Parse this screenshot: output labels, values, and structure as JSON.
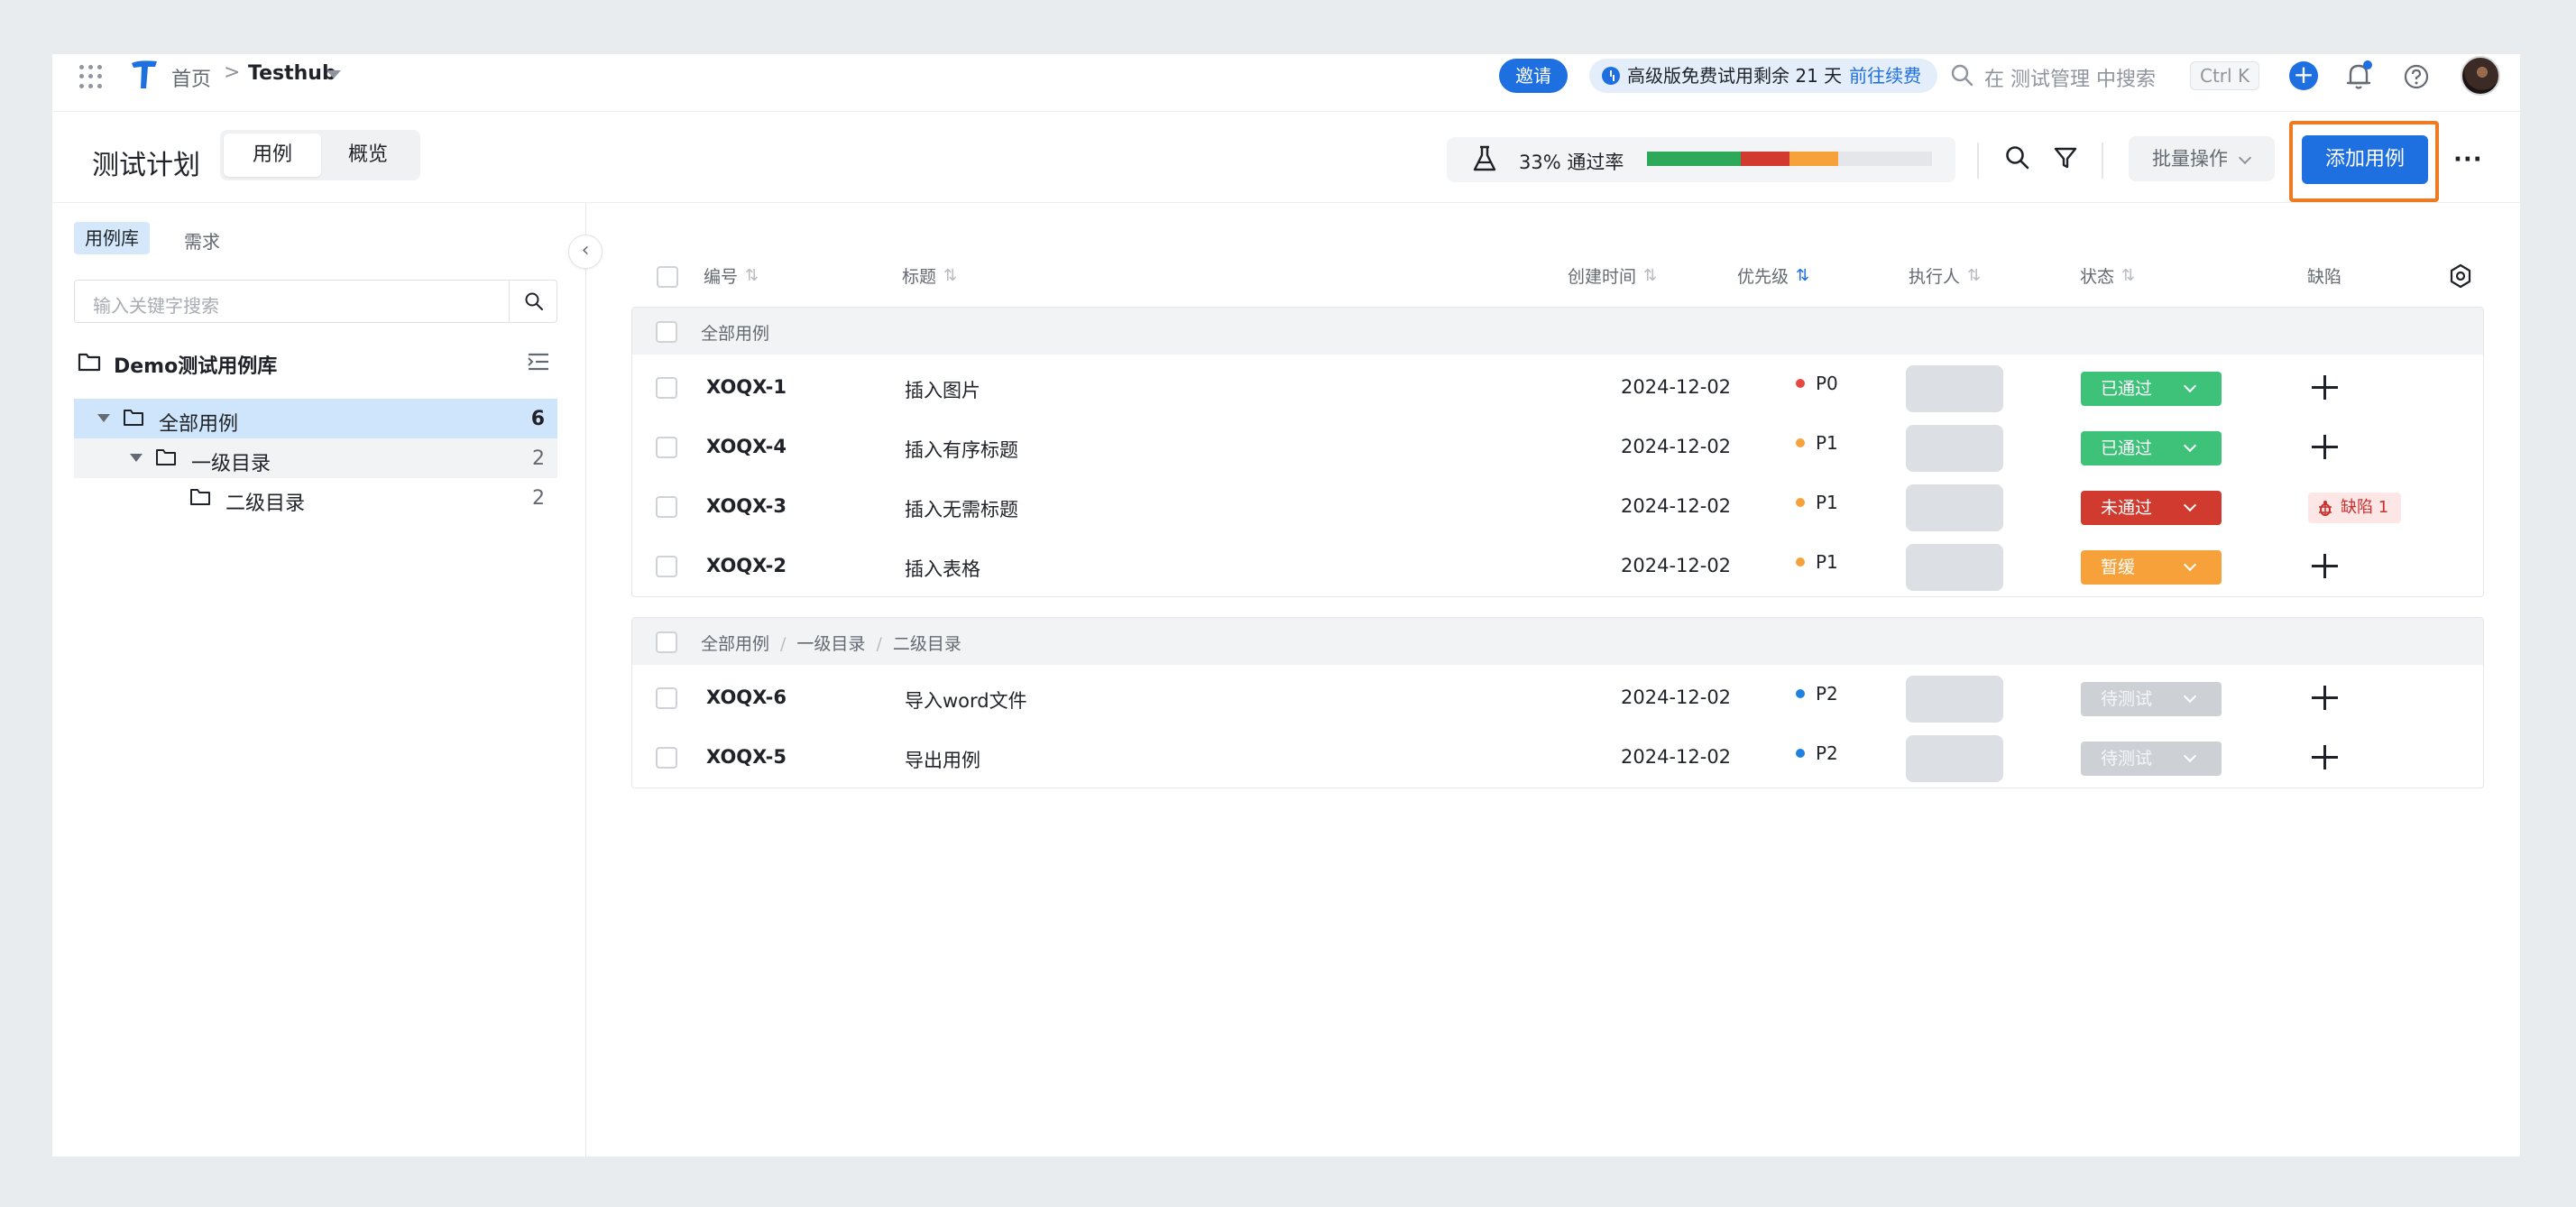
{
  "topbar": {
    "home": "首页",
    "separator": ">",
    "project": "Testhub",
    "invite": "邀请",
    "trial_text": "高级版免费试用剩余 21 天",
    "trial_link": "前往续费",
    "search_placeholder": "在 测试管理 中搜索",
    "search_shortcut": "Ctrl K"
  },
  "header": {
    "title": "测试计划",
    "tabs": [
      {
        "label": "用例",
        "active": true
      },
      {
        "label": "概览",
        "active": false
      }
    ],
    "pass_rate_text": "33% 通过率",
    "pass_bar": [
      {
        "name": "passed",
        "fraction": 0.33,
        "color": "#2ea95a"
      },
      {
        "name": "failed",
        "fraction": 0.17,
        "color": "#d03a2f"
      },
      {
        "name": "blocked",
        "fraction": 0.17,
        "color": "#f7a13b"
      },
      {
        "name": "untested",
        "fraction": 0.33,
        "color": "#e4e6e9"
      }
    ],
    "bulk_label": "批量操作",
    "add_label": "添加用例",
    "more_label": "···"
  },
  "sidebar": {
    "tabs": [
      {
        "label": "用例库",
        "active": true
      },
      {
        "label": "需求",
        "active": false
      }
    ],
    "search_placeholder": "输入关键字搜索",
    "library_name": "Demo测试用例库",
    "tree": [
      {
        "label": "全部用例",
        "count": "6",
        "selected": true
      },
      {
        "label": "一级目录",
        "count": "2",
        "selected": false
      },
      {
        "label": "二级目录",
        "count": "2",
        "selected": false
      }
    ],
    "collapse_icon": "‹"
  },
  "table": {
    "columns": {
      "id": "编号",
      "title": "标题",
      "created": "创建时间",
      "priority": "优先级",
      "executor": "执行人",
      "status": "状态",
      "defect": "缺陷"
    },
    "sort_icon": "⇅",
    "groups": [
      {
        "path": [
          "全部用例"
        ],
        "rows": [
          {
            "id": "XOQX-1",
            "title": "插入图片",
            "date": "2024-12-02",
            "priority": "P0",
            "prio_color": "#e5483f",
            "status": "已通过",
            "status_color": "#3ec27a",
            "defect": ""
          },
          {
            "id": "XOQX-4",
            "title": "插入有序标题",
            "date": "2024-12-02",
            "priority": "P1",
            "prio_color": "#f7a13b",
            "status": "已通过",
            "status_color": "#3ec27a",
            "defect": ""
          },
          {
            "id": "XOQX-3",
            "title": "插入无需标题",
            "date": "2024-12-02",
            "priority": "P1",
            "prio_color": "#f7a13b",
            "status": "未通过",
            "status_color": "#d03a2f",
            "defect": "缺陷 1"
          },
          {
            "id": "XOQX-2",
            "title": "插入表格",
            "date": "2024-12-02",
            "priority": "P1",
            "prio_color": "#f7a13b",
            "status": "暂缓",
            "status_color": "#f7a13b",
            "defect": ""
          }
        ]
      },
      {
        "path": [
          "全部用例",
          "一级目录",
          "二级目录"
        ],
        "rows": [
          {
            "id": "XOQX-6",
            "title": "导入word文件",
            "date": "2024-12-02",
            "priority": "P2",
            "prio_color": "#1e80e0",
            "status": "待测试",
            "status_color": "#cdd1d6",
            "defect": ""
          },
          {
            "id": "XOQX-5",
            "title": "导出用例",
            "date": "2024-12-02",
            "priority": "P2",
            "prio_color": "#1e80e0",
            "status": "待测试",
            "status_color": "#cdd1d6",
            "defect": ""
          }
        ]
      }
    ]
  },
  "icons": [
    "grid-icon",
    "logo-icon",
    "search-icon",
    "plus-icon",
    "bell-icon",
    "help-icon",
    "flask-icon",
    "filter-icon",
    "folder-icon",
    "menu-icon",
    "gear-icon",
    "bug-icon"
  ]
}
